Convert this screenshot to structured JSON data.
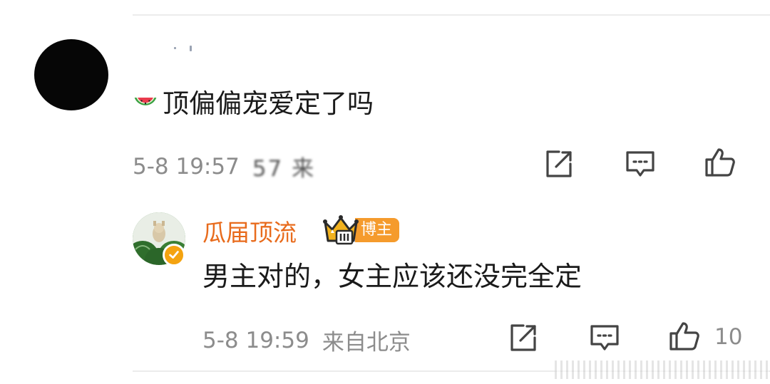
{
  "comment": {
    "emoji_icon": "watermelon-icon",
    "text": "顶偏偏宠爱定了吗",
    "meta": {
      "time": "5-8 19:57",
      "location_blurred": "57 来"
    },
    "actions": {
      "share_icon": "share-icon",
      "reply_icon": "comment-icon",
      "like_icon": "thumbs-up-icon"
    }
  },
  "reply": {
    "author_name": "瓜届顶流",
    "badge": "博主",
    "level_icon": "crown-icon",
    "text": "男主对的，女主应该还没完全定",
    "meta": {
      "time": "5-8 19:59",
      "location": "来自北京"
    },
    "actions": {
      "share_icon": "share-icon",
      "reply_icon": "comment-icon",
      "like_icon": "thumbs-up-icon",
      "like_count": "10"
    }
  },
  "colors": {
    "author_name": "#e86b1c",
    "badge_bg": "#f59b2c",
    "meta_text": "#8c8c8c",
    "body_text": "#1a1a1a"
  }
}
